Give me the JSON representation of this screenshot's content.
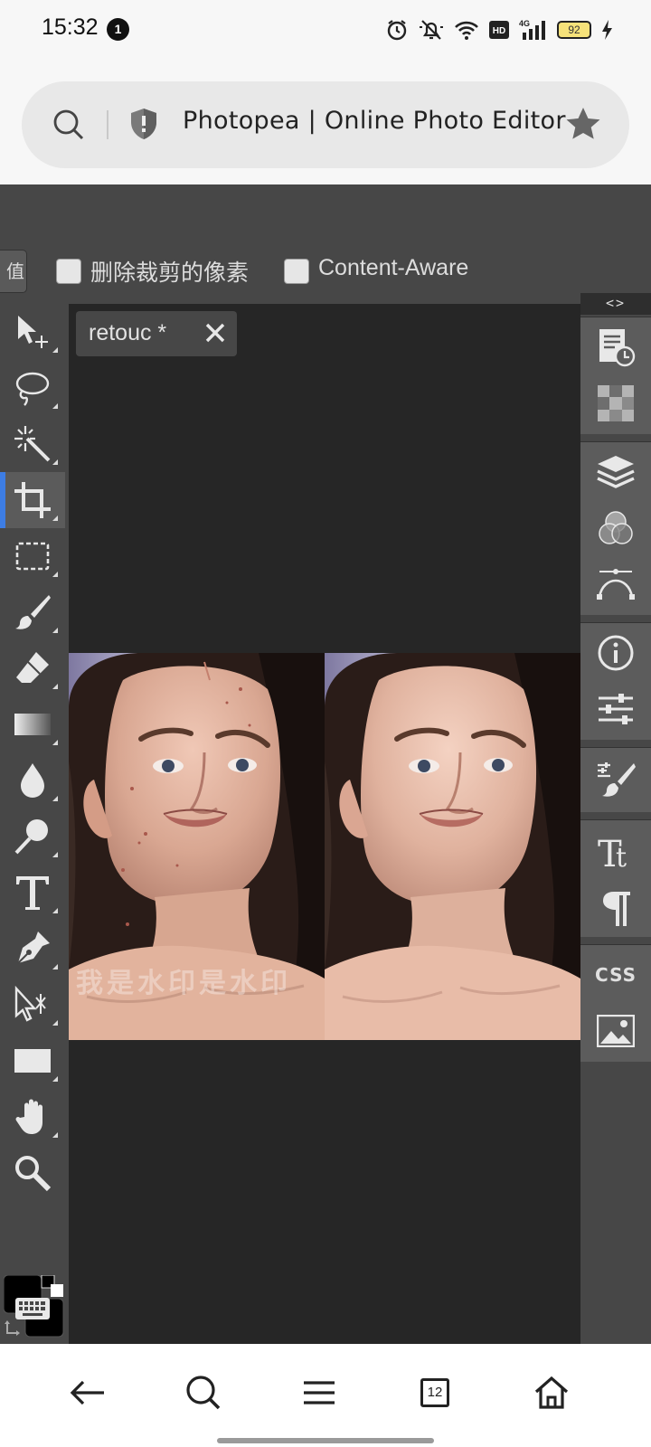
{
  "status_bar": {
    "time": "15:32",
    "notification_count": "1",
    "battery": "92"
  },
  "browser": {
    "page_title": "Photopea | Online Photo Editor"
  },
  "options_bar": {
    "partial_button_label": "值",
    "delete_cropped_label": "删除裁剪的像素",
    "content_aware_label": "Content-Aware"
  },
  "document": {
    "tab_name": "retouc *"
  },
  "image": {
    "watermark": "我是水印是水印"
  },
  "panels": {
    "toggle_label": "<>",
    "css_label": "CSS"
  },
  "nav": {
    "tabs_count": "12"
  },
  "colors": {
    "accent": "#3d7de4",
    "toolbar_bg": "#474747",
    "canvas_bg": "#262626",
    "foreground_color": "#000000",
    "background_color": "#000000"
  }
}
